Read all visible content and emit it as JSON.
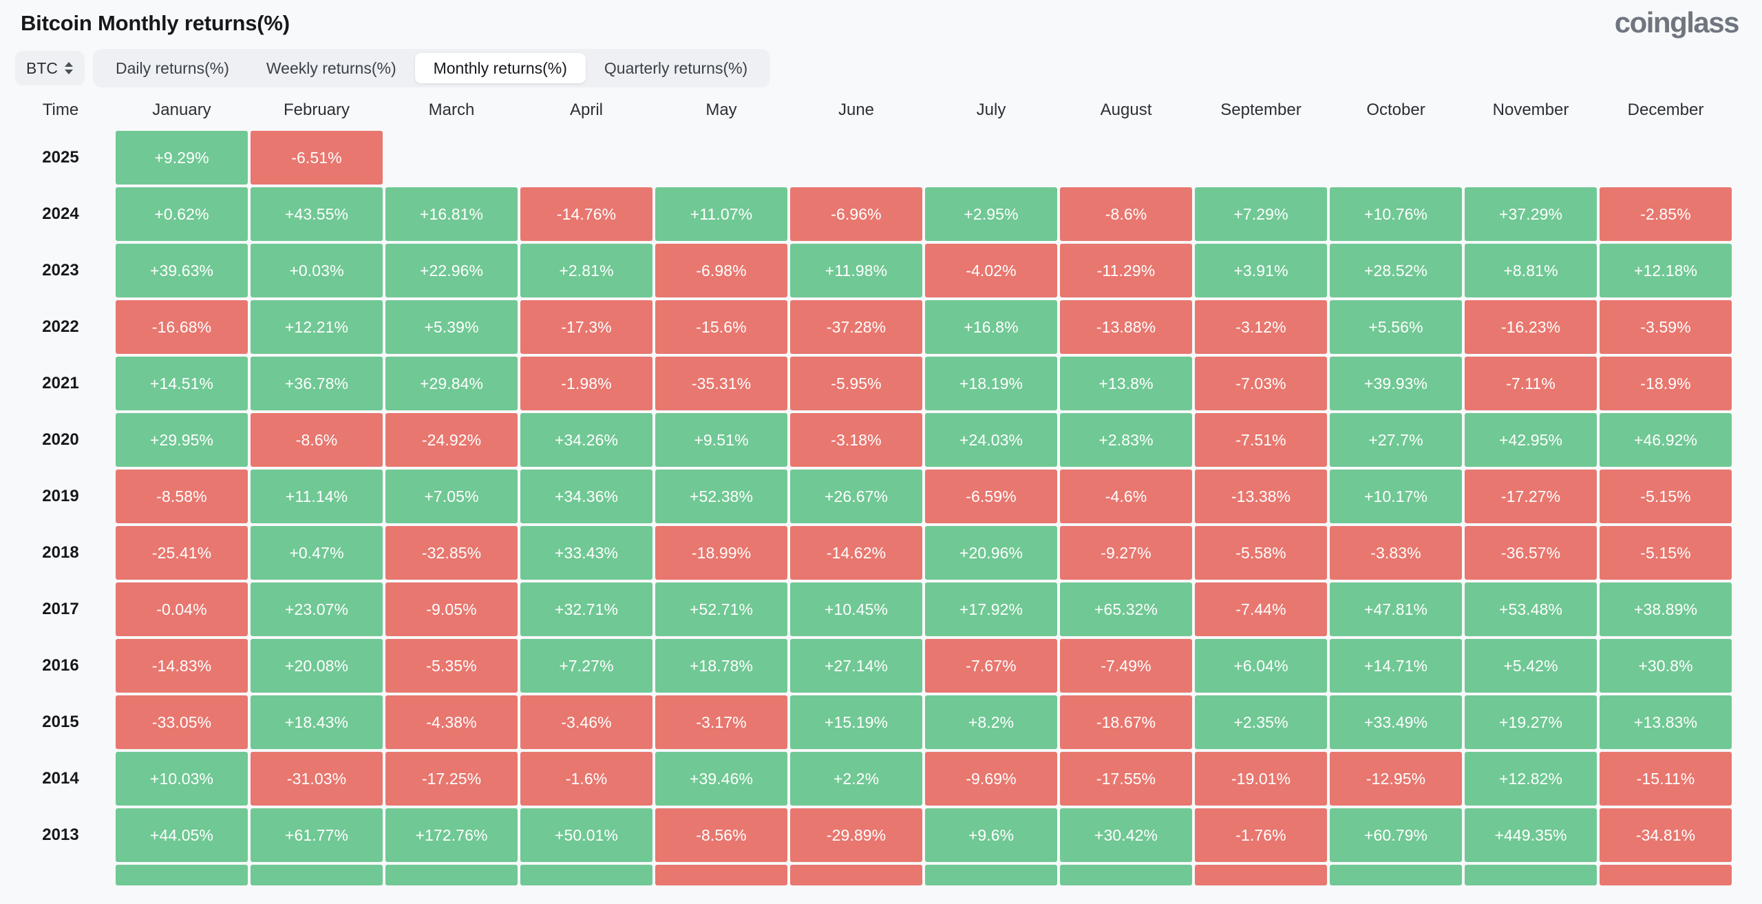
{
  "header": {
    "title": "Bitcoin Monthly returns(%)",
    "brand": "coinglass"
  },
  "controls": {
    "asset_selector": {
      "value": "BTC",
      "icon": "stepper-updown-icon"
    },
    "tabs": [
      {
        "label": "Daily returns(%)",
        "active": false
      },
      {
        "label": "Weekly returns(%)",
        "active": false
      },
      {
        "label": "Monthly returns(%)",
        "active": true
      },
      {
        "label": "Quarterly returns(%)",
        "active": false
      }
    ]
  },
  "colors": {
    "positive": "#70c894",
    "negative": "#e8776f",
    "background": "#f8f9fa",
    "tab_bar": "#eef0f3"
  },
  "chart_data": {
    "type": "heatmap",
    "title": "Bitcoin Monthly returns(%)",
    "xlabel": "",
    "ylabel": "Time",
    "columns": [
      "Time",
      "January",
      "February",
      "March",
      "April",
      "May",
      "June",
      "July",
      "August",
      "September",
      "October",
      "November",
      "December"
    ],
    "rows": [
      {
        "year": "2025",
        "values": [
          "+9.29%",
          "-6.51%",
          "",
          "",
          "",
          "",
          "",
          "",
          "",
          "",
          "",
          ""
        ]
      },
      {
        "year": "2024",
        "values": [
          "+0.62%",
          "+43.55%",
          "+16.81%",
          "-14.76%",
          "+11.07%",
          "-6.96%",
          "+2.95%",
          "-8.6%",
          "+7.29%",
          "+10.76%",
          "+37.29%",
          "-2.85%"
        ]
      },
      {
        "year": "2023",
        "values": [
          "+39.63%",
          "+0.03%",
          "+22.96%",
          "+2.81%",
          "-6.98%",
          "+11.98%",
          "-4.02%",
          "-11.29%",
          "+3.91%",
          "+28.52%",
          "+8.81%",
          "+12.18%"
        ]
      },
      {
        "year": "2022",
        "values": [
          "-16.68%",
          "+12.21%",
          "+5.39%",
          "-17.3%",
          "-15.6%",
          "-37.28%",
          "+16.8%",
          "-13.88%",
          "-3.12%",
          "+5.56%",
          "-16.23%",
          "-3.59%"
        ]
      },
      {
        "year": "2021",
        "values": [
          "+14.51%",
          "+36.78%",
          "+29.84%",
          "-1.98%",
          "-35.31%",
          "-5.95%",
          "+18.19%",
          "+13.8%",
          "-7.03%",
          "+39.93%",
          "-7.11%",
          "-18.9%"
        ]
      },
      {
        "year": "2020",
        "values": [
          "+29.95%",
          "-8.6%",
          "-24.92%",
          "+34.26%",
          "+9.51%",
          "-3.18%",
          "+24.03%",
          "+2.83%",
          "-7.51%",
          "+27.7%",
          "+42.95%",
          "+46.92%"
        ]
      },
      {
        "year": "2019",
        "values": [
          "-8.58%",
          "+11.14%",
          "+7.05%",
          "+34.36%",
          "+52.38%",
          "+26.67%",
          "-6.59%",
          "-4.6%",
          "-13.38%",
          "+10.17%",
          "-17.27%",
          "-5.15%"
        ]
      },
      {
        "year": "2018",
        "values": [
          "-25.41%",
          "+0.47%",
          "-32.85%",
          "+33.43%",
          "-18.99%",
          "-14.62%",
          "+20.96%",
          "-9.27%",
          "-5.58%",
          "-3.83%",
          "-36.57%",
          "-5.15%"
        ]
      },
      {
        "year": "2017",
        "values": [
          "-0.04%",
          "+23.07%",
          "-9.05%",
          "+32.71%",
          "+52.71%",
          "+10.45%",
          "+17.92%",
          "+65.32%",
          "-7.44%",
          "+47.81%",
          "+53.48%",
          "+38.89%"
        ]
      },
      {
        "year": "2016",
        "values": [
          "-14.83%",
          "+20.08%",
          "-5.35%",
          "+7.27%",
          "+18.78%",
          "+27.14%",
          "-7.67%",
          "-7.49%",
          "+6.04%",
          "+14.71%",
          "+5.42%",
          "+30.8%"
        ]
      },
      {
        "year": "2015",
        "values": [
          "-33.05%",
          "+18.43%",
          "-4.38%",
          "-3.46%",
          "-3.17%",
          "+15.19%",
          "+8.2%",
          "-18.67%",
          "+2.35%",
          "+33.49%",
          "+19.27%",
          "+13.83%"
        ]
      },
      {
        "year": "2014",
        "values": [
          "+10.03%",
          "-31.03%",
          "-17.25%",
          "-1.6%",
          "+39.46%",
          "+2.2%",
          "-9.69%",
          "-17.55%",
          "-19.01%",
          "-12.95%",
          "+12.82%",
          "-15.11%"
        ]
      },
      {
        "year": "2013",
        "values": [
          "+44.05%",
          "+61.77%",
          "+172.76%",
          "+50.01%",
          "-8.56%",
          "-29.89%",
          "+9.6%",
          "+30.42%",
          "-1.76%",
          "+60.79%",
          "+449.35%",
          "-34.81%"
        ]
      },
      {
        "year": "",
        "values": [
          "+",
          "+",
          "+",
          "+",
          "-",
          "-",
          "+",
          "+",
          "-",
          "+",
          "+",
          "-"
        ],
        "partial": true
      }
    ]
  }
}
